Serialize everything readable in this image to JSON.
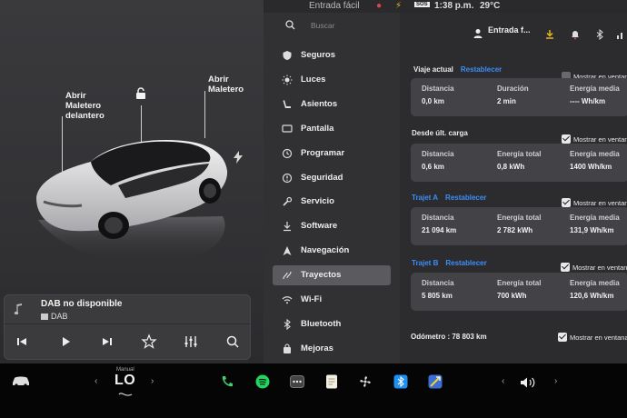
{
  "status_bar": {
    "nav_text": "Entrada fácil",
    "badge": "SOS",
    "time": "1:38 p.m.",
    "temperature": "29°C"
  },
  "car": {
    "labels": {
      "frunk": "Abrir\nMaletero\ndelantero",
      "trunk": "Abrir\nMaletero"
    }
  },
  "media": {
    "title": "DAB no disponible",
    "source": "DAB"
  },
  "search": {
    "placeholder": "Buscar"
  },
  "nav": {
    "items": [
      {
        "label": "Seguros",
        "icon": "shield-icon"
      },
      {
        "label": "Luces",
        "icon": "sun-icon"
      },
      {
        "label": "Asientos",
        "icon": "seat-icon"
      },
      {
        "label": "Pantalla",
        "icon": "display-icon"
      },
      {
        "label": "Programar",
        "icon": "clock-icon"
      },
      {
        "label": "Seguridad",
        "icon": "alert-circle-icon"
      },
      {
        "label": "Servicio",
        "icon": "wrench-icon"
      },
      {
        "label": "Software",
        "icon": "download-icon"
      },
      {
        "label": "Navegación",
        "icon": "navigation-icon"
      },
      {
        "label": "Trayectos",
        "icon": "trips-icon",
        "active": true
      },
      {
        "label": "Wi-Fi",
        "icon": "wifi-icon"
      },
      {
        "label": "Bluetooth",
        "icon": "bluetooth-icon"
      },
      {
        "label": "Mejoras",
        "icon": "bag-icon"
      }
    ]
  },
  "header": {
    "profile_label": "Entrada f..."
  },
  "trips": {
    "reset_label": "Restablecer",
    "show_label": "Mostrar en ventana",
    "sections": [
      {
        "title": "Viaje actual",
        "has_reset": true,
        "show_checked": false,
        "cells": [
          {
            "k": "Distancia",
            "v": "0,0 km"
          },
          {
            "k": "Duración",
            "v": "2 min"
          },
          {
            "k": "Energía media",
            "v": "---- Wh/km"
          }
        ]
      },
      {
        "title": "Desde últ. carga",
        "has_reset": false,
        "show_checked": true,
        "cells": [
          {
            "k": "Distancia",
            "v": "0,6 km"
          },
          {
            "k": "Energía total",
            "v": "0,8 kWh"
          },
          {
            "k": "Energía media",
            "v": "1400 Wh/km"
          }
        ]
      },
      {
        "title": "Trajet A",
        "has_reset": true,
        "show_checked": true,
        "cells": [
          {
            "k": "Distancia",
            "v": "21 094 km"
          },
          {
            "k": "Energía total",
            "v": "2 782 kWh"
          },
          {
            "k": "Energía media",
            "v": "131,9 Wh/km"
          }
        ]
      },
      {
        "title": "Trajet B",
        "has_reset": true,
        "show_checked": true,
        "cells": [
          {
            "k": "Distancia",
            "v": "5 805 km"
          },
          {
            "k": "Energía total",
            "v": "700 kWh"
          },
          {
            "k": "Energía media",
            "v": "120,6 Wh/km"
          }
        ]
      }
    ],
    "odometer_label": "Odómetro :",
    "odometer_value": "78 803 km",
    "odometer_show_checked": true
  },
  "dock": {
    "climate_mode": "Manual",
    "climate_temp": "LO"
  },
  "colors": {
    "accent": "#3e8ef7",
    "panel_dark": "#2c2c2f",
    "card": "#434347"
  }
}
